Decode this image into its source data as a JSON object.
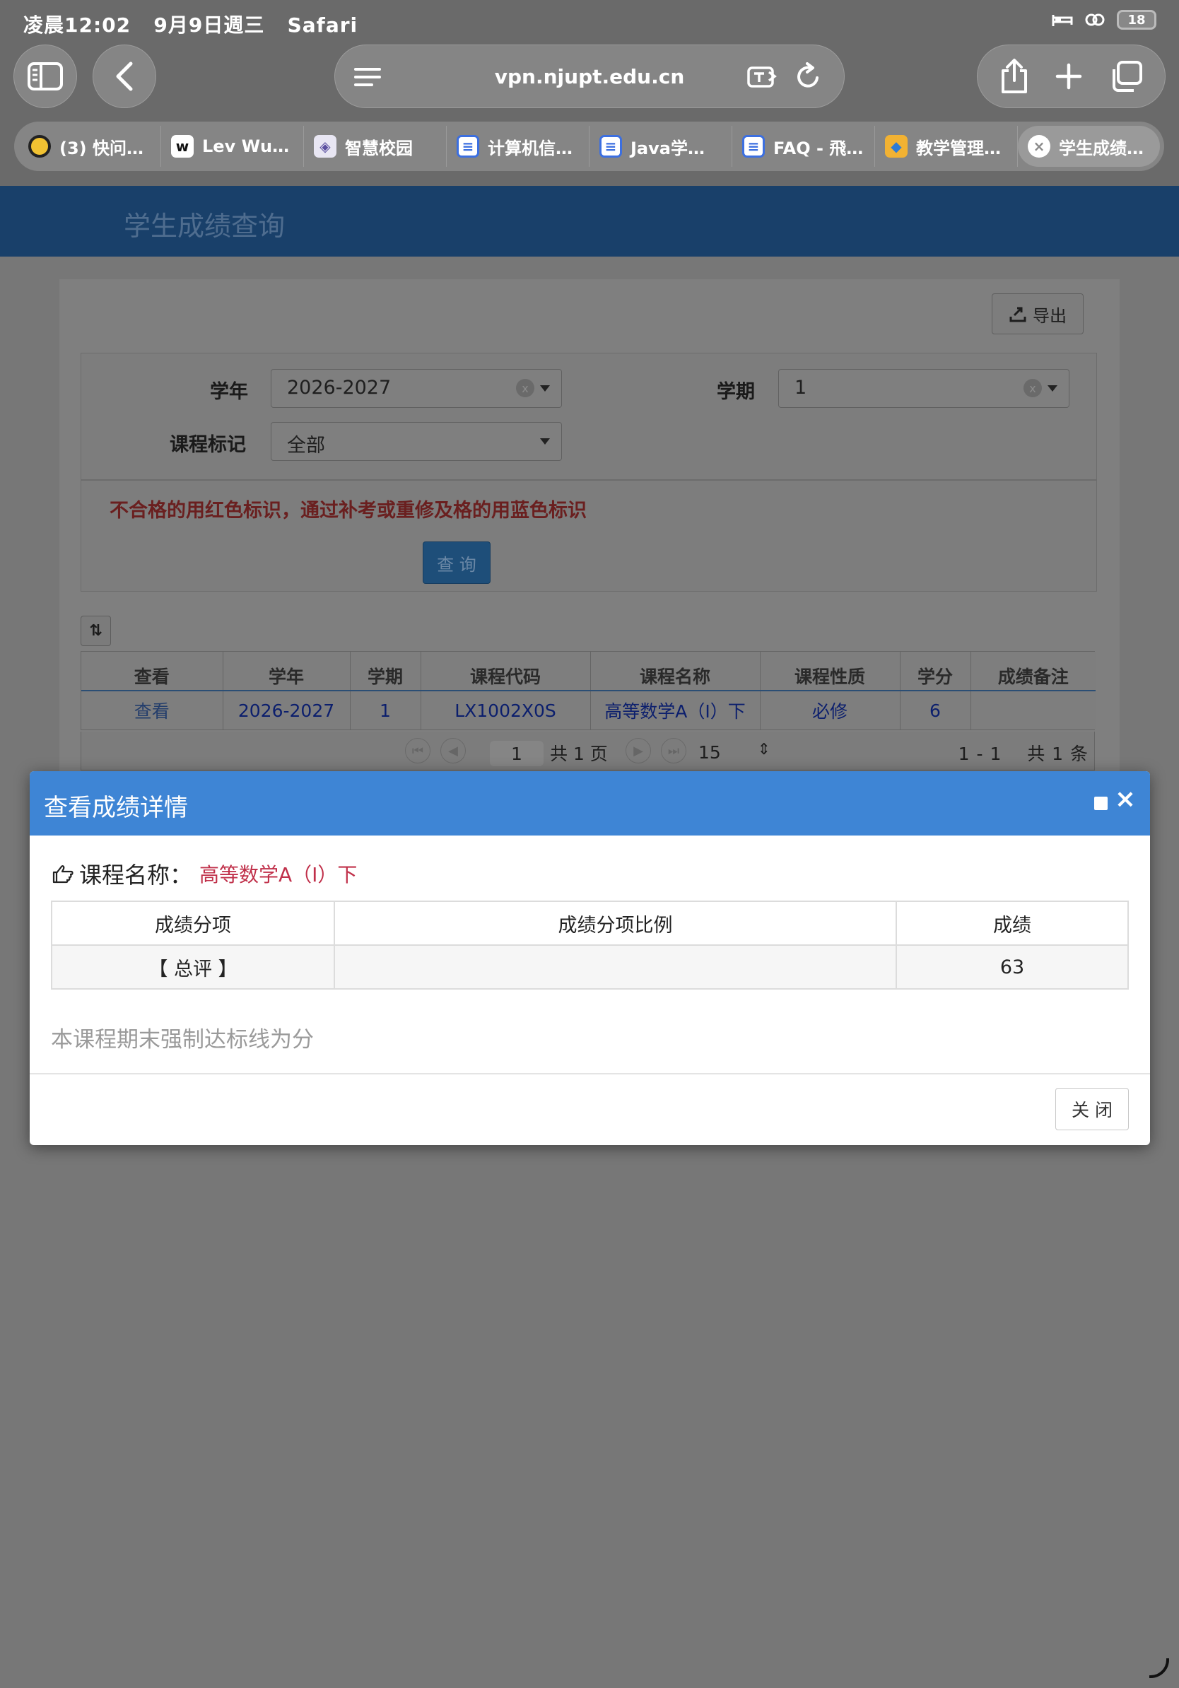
{
  "status": {
    "time": "凌晨12:02",
    "date": "9月9日週三",
    "app": "Safari",
    "battery": "18"
  },
  "browser": {
    "url": "vpn.njupt.edu.cn",
    "tabs": [
      {
        "label": "(3) 快问…",
        "icon": "circle-favicon-icon",
        "color": "#f1c232"
      },
      {
        "label": "Lev Wu…",
        "icon": "handwriting-w-favicon-icon",
        "color": "#ffffff"
      },
      {
        "label": "智慧校园",
        "icon": "shield-favicon-icon",
        "color": "#5a4fa0"
      },
      {
        "label": "计算机信…",
        "icon": "doc-favicon-icon",
        "color": "#3c6fe0"
      },
      {
        "label": "Java学…",
        "icon": "doc-favicon-icon",
        "color": "#3c6fe0"
      },
      {
        "label": "FAQ - 飛…",
        "icon": "doc-favicon-icon",
        "color": "#3c6fe0"
      },
      {
        "label": "教学管理…",
        "icon": "cube-favicon-icon",
        "color": "#2d7bd6"
      },
      {
        "label": "学生成绩…",
        "icon": "close-tab-icon",
        "color": "#ffffff"
      }
    ]
  },
  "page": {
    "header_title": "学生成绩查询",
    "export_label": "导出",
    "filters": {
      "year_label": "学年",
      "year_value": "2026-2027",
      "term_label": "学期",
      "term_value": "1",
      "mark_label": "课程标记",
      "mark_value": "全部",
      "clear_glyph": "x"
    },
    "notice": "不合格的用红色标识，通过补考或重修及格的用蓝色标识",
    "query_label": "查 询",
    "grid": {
      "columns": [
        "查看",
        "学年",
        "学期",
        "课程代码",
        "课程名称",
        "课程性质",
        "学分",
        "成绩备注"
      ],
      "rows": [
        [
          "查看",
          "2026-2027",
          "1",
          "LX1002X0S",
          "高等数学A（I）下",
          "必修",
          "6",
          ""
        ]
      ]
    },
    "pager": {
      "page": "1",
      "total_pages": "共 1 页",
      "page_size": "15",
      "range": "1 - 1",
      "total_records": "共 1 条"
    }
  },
  "modal": {
    "title": "查看成绩详情",
    "course_label": "课程名称：",
    "course_name": "高等数学A（I）下",
    "table_columns": [
      "成绩分项",
      "成绩分项比例",
      "成绩"
    ],
    "table_rows": [
      [
        "【 总评 】",
        "",
        "63"
      ]
    ],
    "note": "本课程期末强制达标线为分",
    "close_label": "关 闭",
    "accent_color": "#3e85d5"
  }
}
